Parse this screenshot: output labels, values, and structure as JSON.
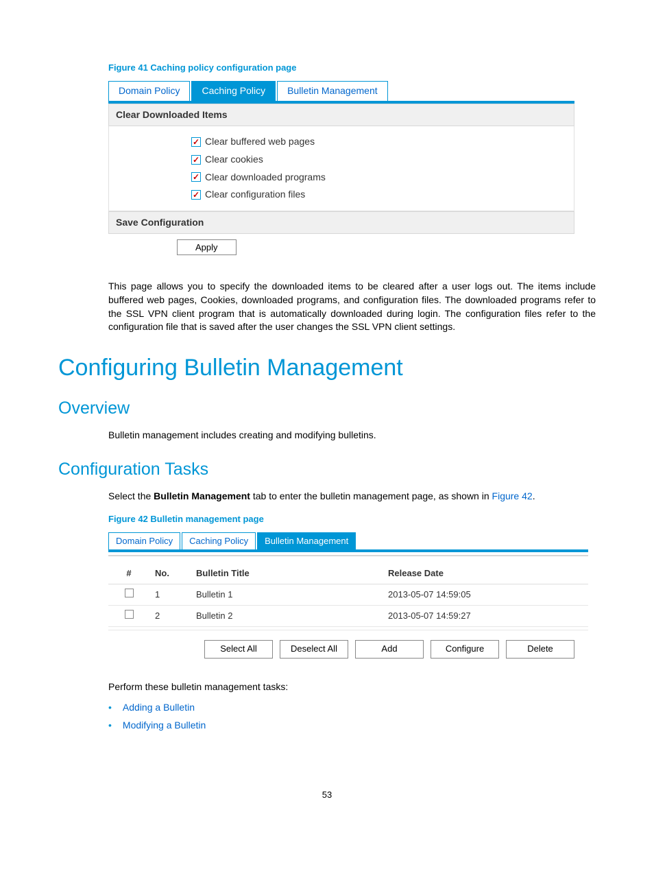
{
  "figure41": {
    "caption": "Figure 41 Caching policy configuration page",
    "tabs": {
      "domain": "Domain Policy",
      "caching": "Caching Policy",
      "bulletin": "Bulletin Management"
    },
    "section1_header": "Clear Downloaded Items",
    "checks": {
      "pages": "Clear buffered web pages",
      "cookies": "Clear cookies",
      "programs": "Clear downloaded programs",
      "config": "Clear configuration files"
    },
    "section2_header": "Save Configuration",
    "apply_label": "Apply"
  },
  "para_caching": "This page allows you to specify the downloaded items to be cleared after a user logs out. The items include buffered web pages, Cookies, downloaded programs, and configuration files. The downloaded programs refer to the SSL VPN client program that is automatically downloaded during login. The configuration files refer to the configuration file that is saved after the user changes the SSL VPN client settings.",
  "h1_bulletin": "Configuring Bulletin Management",
  "h2_overview": "Overview",
  "overview_text": "Bulletin management includes creating and modifying bulletins.",
  "h2_tasks": "Configuration Tasks",
  "tasks_intro_pre": "Select the ",
  "tasks_intro_bold": "Bulletin Management",
  "tasks_intro_post": " tab to enter the bulletin management page, as shown in ",
  "tasks_intro_link": "Figure 42",
  "figure42": {
    "caption": "Figure 42 Bulletin management page",
    "tabs": {
      "domain": "Domain Policy",
      "caching": "Caching Policy",
      "bulletin": "Bulletin Management"
    },
    "headers": {
      "hash": "#",
      "no": "No.",
      "title": "Bulletin Title",
      "date": "Release Date"
    },
    "rows": [
      {
        "no": "1",
        "title": "Bulletin 1",
        "date": "2013-05-07 14:59:05"
      },
      {
        "no": "2",
        "title": "Bulletin 2",
        "date": "2013-05-07 14:59:27"
      }
    ],
    "buttons": {
      "select": "Select All",
      "deselect": "Deselect All",
      "add": "Add",
      "configure": "Configure",
      "delete": "Delete"
    }
  },
  "tasks_after": "Perform these bulletin management tasks:",
  "tasks_list": {
    "add": "Adding a Bulletin",
    "modify": "Modifying a Bulletin"
  },
  "page_number": "53"
}
